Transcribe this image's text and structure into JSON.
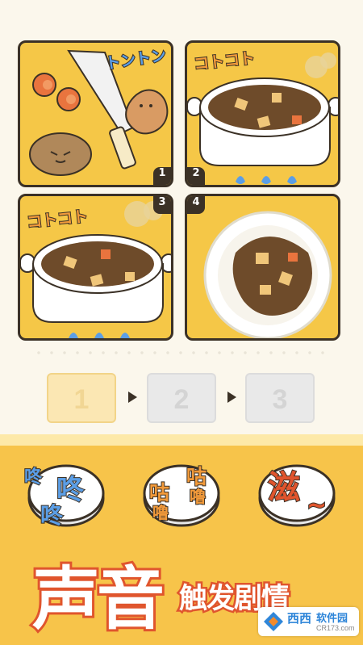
{
  "comic": {
    "panels": [
      {
        "number": "1",
        "sfx": "トントン"
      },
      {
        "number": "2",
        "sfx": "コトコト"
      },
      {
        "number": "3",
        "sfx": "コトコト"
      },
      {
        "number": "4",
        "sfx": ""
      }
    ]
  },
  "answer": {
    "slots": [
      "1",
      "2",
      "3"
    ]
  },
  "sound_buttons": [
    {
      "id": "dong",
      "lines": [
        "咚",
        "咚",
        "咚"
      ]
    },
    {
      "id": "gulu",
      "lines": [
        "咕",
        "噜",
        "咕",
        "噜"
      ]
    },
    {
      "id": "sizzle",
      "lines": [
        "滋",
        "~"
      ]
    }
  ],
  "banner": {
    "title": "声音",
    "subtitle": "触发剧情"
  },
  "watermark": {
    "brand": "西西",
    "site_text": "软件园",
    "url": "CR173.com"
  },
  "colors": {
    "panel_yellow": "#f5c747",
    "outline": "#3b3126",
    "curry": "#6e4b2a",
    "title_stroke": "#e0552d",
    "sfx_blue": "#5b9ee6",
    "sfx_orange": "#f29a3a"
  }
}
